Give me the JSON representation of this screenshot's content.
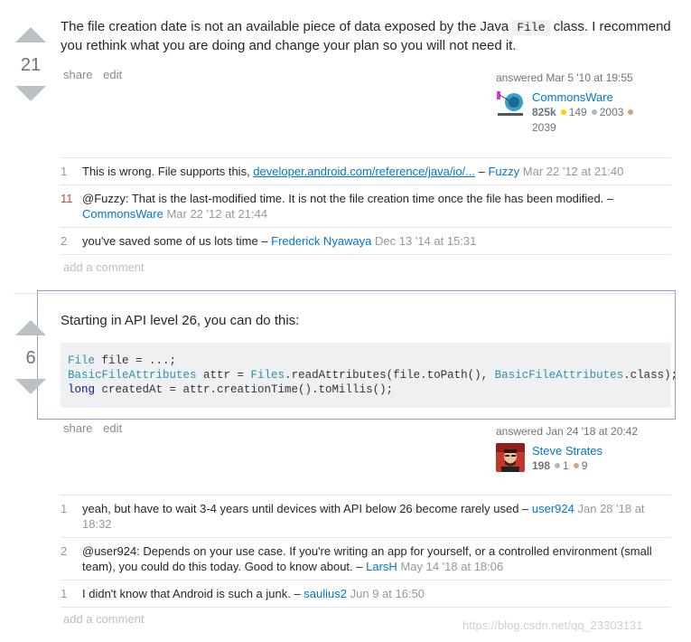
{
  "answer1": {
    "votes": "21",
    "text_part1": "The file creation date is not an available piece of data exposed by the Java ",
    "code_inline": "File",
    "text_part2": " class. I recommend you rethink what you are doing and change your plan so you will not need it.",
    "menu": {
      "share": "share",
      "edit": "edit"
    },
    "signature": {
      "time": "answered Mar 5 '10 at 19:55",
      "user": "CommonsWare",
      "rep": "825k",
      "gold": "149",
      "silver": "2003",
      "bronze": "2039"
    },
    "comments": [
      {
        "score": "1",
        "text": "This is wrong. File supports this, ",
        "link": "developer.android.com/reference/java/io/...",
        "sep": " – ",
        "user": "Fuzzy",
        "date": "Mar 22 '12 at 21:40"
      },
      {
        "score": "11",
        "text": "@Fuzzy: That is the last-modified time. It is not the file creation time once the file has been modified. – ",
        "user": "CommonsWare",
        "date": "Mar 22 '12 at 21:44"
      },
      {
        "score": "2",
        "text": "you've saved some of us lots time – ",
        "user": "Frederick Nyawaya",
        "date": "Dec 13 '14 at 15:31"
      }
    ],
    "add_comment": "add a comment"
  },
  "answer2": {
    "votes": "6",
    "text": "Starting in API level 26, you can do this:",
    "code": {
      "l1_type": "File",
      "l1_rest": " file = ...;",
      "l2_type": "BasicFileAttributes",
      "l2_mid": " attr = ",
      "l2_type2": "Files",
      "l2_mid2": ".readAttributes(file.toPath(), ",
      "l2_type3": "BasicFileAttributes",
      "l2_end": ".class);",
      "l3_kw": "long",
      "l3_rest": " createdAt = attr.creationTime().toMillis();"
    },
    "menu": {
      "share": "share",
      "edit": "edit"
    },
    "signature": {
      "time": "answered Jan 24 '18 at 20:42",
      "user": "Steve Strates",
      "rep": "198",
      "silver": "1",
      "bronze": "9"
    },
    "comments": [
      {
        "score": "1",
        "text": "yeah, but have to wait 3-4 years until devices with API below 26 become rarely used – ",
        "user": "user924",
        "date": "Jan 28 '18 at 18:32"
      },
      {
        "score": "2",
        "text": "@user924: Depends on your use case. If you're writing an app for yourself, or a controlled environment (small team), you could do this today. Good to know about. – ",
        "user": "LarsH",
        "date": "May 14 '18 at 18:06"
      },
      {
        "score": "1",
        "text": "I didn't know that Android is such a junk. – ",
        "user": "saulius2",
        "date": "Jun 9 at 16:50"
      }
    ],
    "add_comment": "add a comment"
  },
  "watermark": "https://blog.csdn.net/qq_23303131",
  "colors": {
    "link": "#0077cc",
    "vote_arrow": "#bbc0c4",
    "highlight_border": "#8ba0d8"
  }
}
